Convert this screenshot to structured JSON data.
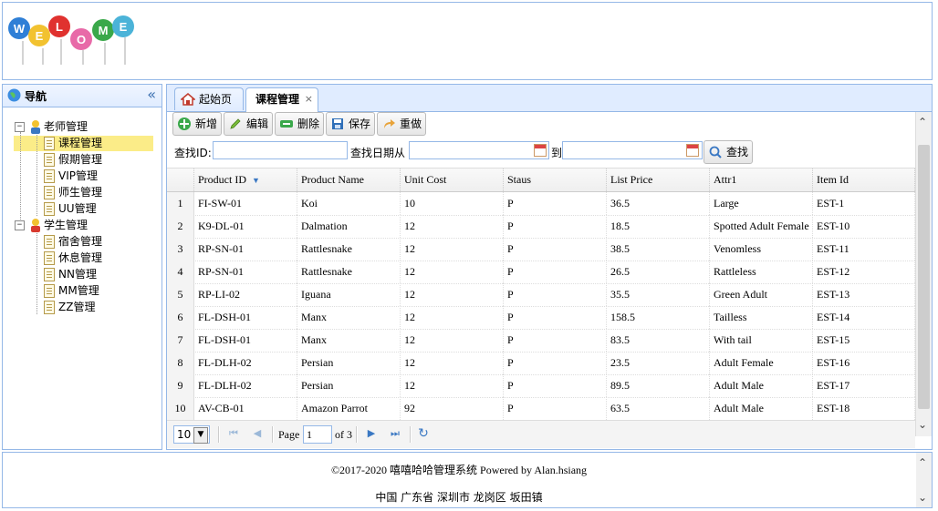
{
  "header": {
    "logo_text": "WELCOME"
  },
  "nav": {
    "title": "导航",
    "collapse_icon": "«",
    "tree": {
      "teacher": "老师管理",
      "teacher_items": [
        "课程管理",
        "假期管理",
        "VIP管理",
        "师生管理",
        "UU管理"
      ],
      "student": "学生管理",
      "student_items": [
        "宿舍管理",
        "休息管理",
        "NN管理",
        "MM管理",
        "ZZ管理"
      ]
    }
  },
  "tabs": [
    {
      "label": "起始页",
      "active": false
    },
    {
      "label": "课程管理",
      "active": true,
      "close": "×"
    }
  ],
  "toolbar": {
    "add": "新增",
    "edit": "编辑",
    "delete": "删除",
    "save": "保存",
    "redo": "重做"
  },
  "search": {
    "id_label": "查找ID:",
    "id_value": "",
    "date_from_label": "查找日期从",
    "date_from_value": "",
    "to_label": "到",
    "date_to_value": "",
    "button": "查找"
  },
  "grid": {
    "columns": [
      "Product ID",
      "Product Name",
      "Unit Cost",
      "Staus",
      "List Price",
      "Attr1",
      "Item Id"
    ],
    "sort_indicator": "▼",
    "rows": [
      [
        "1",
        "FI-SW-01",
        "Koi",
        "10",
        "P",
        "36.5",
        "Large",
        "EST-1"
      ],
      [
        "2",
        "K9-DL-01",
        "Dalmation",
        "12",
        "P",
        "18.5",
        "Spotted Adult Female",
        "EST-10"
      ],
      [
        "3",
        "RP-SN-01",
        "Rattlesnake",
        "12",
        "P",
        "38.5",
        "Venomless",
        "EST-11"
      ],
      [
        "4",
        "RP-SN-01",
        "Rattlesnake",
        "12",
        "P",
        "26.5",
        "Rattleless",
        "EST-12"
      ],
      [
        "5",
        "RP-LI-02",
        "Iguana",
        "12",
        "P",
        "35.5",
        "Green Adult",
        "EST-13"
      ],
      [
        "6",
        "FL-DSH-01",
        "Manx",
        "12",
        "P",
        "158.5",
        "Tailless",
        "EST-14"
      ],
      [
        "7",
        "FL-DSH-01",
        "Manx",
        "12",
        "P",
        "83.5",
        "With tail",
        "EST-15"
      ],
      [
        "8",
        "FL-DLH-02",
        "Persian",
        "12",
        "P",
        "23.5",
        "Adult Female",
        "EST-16"
      ],
      [
        "9",
        "FL-DLH-02",
        "Persian",
        "12",
        "P",
        "89.5",
        "Adult Male",
        "EST-17"
      ],
      [
        "10",
        "AV-CB-01",
        "Amazon Parrot",
        "92",
        "P",
        "63.5",
        "Adult Male",
        "EST-18"
      ]
    ]
  },
  "pager": {
    "page_size": "10",
    "page_label": "Page",
    "current_page": "1",
    "of_label": "of 3",
    "first_icon": "⏮",
    "prev_icon": "◀",
    "next_icon": "▶",
    "last_icon": "⏭",
    "refresh_icon": "↻"
  },
  "footer": {
    "copyright": "©2017-2020 嘻嘻哈哈管理系统 Powered by Alan.hsiang",
    "address": "中国 广东省 深圳市 龙岗区 坂田镇"
  },
  "scroll": {
    "up": "⌃",
    "down": "⌄"
  },
  "colors": {
    "border": "#95b8e7",
    "header_bg": "#e0ecff",
    "selected_row": "#fbec88"
  }
}
